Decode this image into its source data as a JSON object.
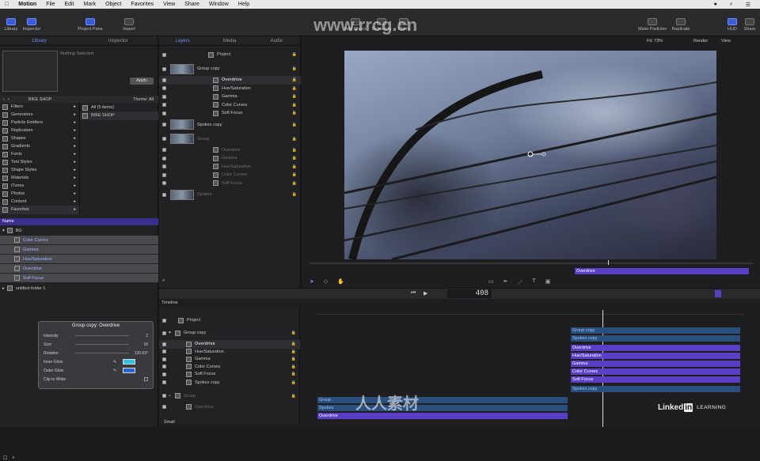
{
  "menubar": {
    "app": "Motion",
    "items": [
      "File",
      "Edit",
      "Mark",
      "Object",
      "Favorites",
      "View",
      "Share",
      "Window",
      "Help"
    ]
  },
  "toolbar": {
    "library": "Library",
    "inspector": "Inspector",
    "project_pane": "Project Pane",
    "import": "Import",
    "add_object": "Add Object",
    "behaviors": "Behaviors",
    "filters": "Filters",
    "make_particles": "Make Particles",
    "replicate": "Replicate",
    "hud": "HUD",
    "share": "Share"
  },
  "watermark_url": "www.rrcg.cn",
  "left_tabs": {
    "library": "Library",
    "inspector": "Inspector"
  },
  "preview": {
    "nothing": "Nothing Selected",
    "apply": "Apply"
  },
  "library": {
    "path": "BIKE SHOP",
    "theme": "Theme: All",
    "categories": [
      "Filters",
      "Generators",
      "Particle Emitters",
      "Replicators",
      "Shapes",
      "Gradients",
      "Fonts",
      "Text Styles",
      "Shape Styles",
      "Materials",
      "iTunes",
      "Photos",
      "Content",
      "Favorites"
    ],
    "items": [
      "All (5 items)",
      "BIKE SHOP"
    ]
  },
  "name_list": {
    "header": "Name",
    "folder": "BG",
    "items": [
      "Color Curves",
      "Gamma",
      "Hue/Saturation",
      "Overdrive",
      "Soft Focus"
    ],
    "untitled": "untitled folder 1"
  },
  "hud": {
    "title": "Group copy: Overdrive",
    "rows": [
      {
        "label": "Intensity",
        "value": "2"
      },
      {
        "label": "Size",
        "value": "16"
      },
      {
        "label": "Rotation",
        "value": "120.69°"
      }
    ],
    "inner_glow": "Inner Glow",
    "outer_glow": "Outer Glow",
    "clip": "Clip to White"
  },
  "mid_tabs": {
    "layers": "Layers",
    "media": "Media",
    "audio": "Audio"
  },
  "layers": {
    "project": "Project",
    "group_copy": "Group copy",
    "filters": [
      "Overdrive",
      "Hue/Saturation",
      "Gamma",
      "Color Curves",
      "Soft Focus"
    ],
    "spokes_copy": "Spokes copy",
    "group": "Group",
    "group_filters": [
      "Overdrive",
      "Gamma",
      "Hue/Saturation",
      "Color Curves",
      "Soft Focus"
    ],
    "spokes": "Spokes"
  },
  "canvas": {
    "fit": "Fit: 73%",
    "render": "Render",
    "view": "View",
    "overdrive_bar": "Overdrive"
  },
  "transport": {
    "timecode": "408"
  },
  "timeline": {
    "label": "Timeline",
    "project": "Project",
    "group_copy": "Group copy",
    "filters": [
      "Overdrive",
      "Hue/Saturation",
      "Gamma",
      "Color Curves",
      "Soft Focus"
    ],
    "spokes_copy": "Spokes copy",
    "group": "Group",
    "overdrive2": "Overdrive",
    "bars": {
      "group_copy": "Group copy",
      "spokes_copy": "Spokes copy",
      "overdrive": "Overdrive",
      "hue": "Hue/Saturation",
      "gamma": "Gamma",
      "curves": "Color Curves",
      "soft": "Soft Focus",
      "spokes_copy2": "Spokes copy",
      "group": "Group",
      "spokes": "Spokes",
      "overdrive3": "Overdrive"
    }
  },
  "bottom": {
    "size": "Small"
  },
  "branding": {
    "linkedin": "Linked",
    "in": "in",
    "learning": "LEARNING",
    "cn_watermark": "人人素材"
  }
}
